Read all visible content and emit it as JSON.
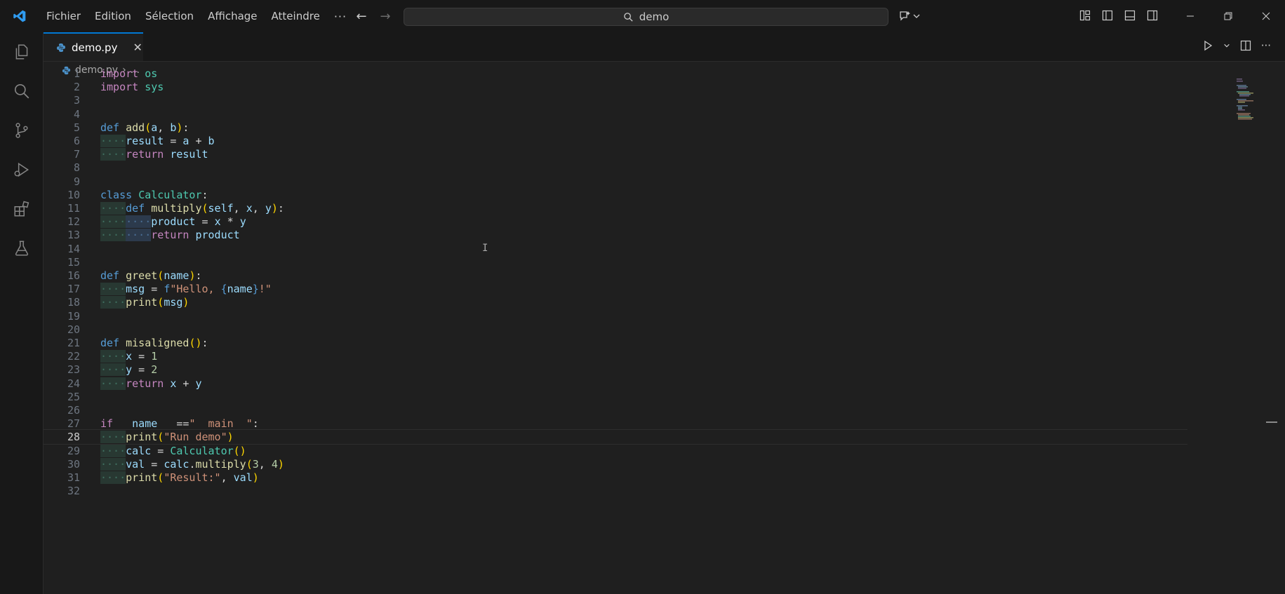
{
  "menu": {
    "items": [
      "Fichier",
      "Edition",
      "Sélection",
      "Affichage",
      "Atteindre"
    ],
    "more": "···"
  },
  "search": {
    "text": "demo"
  },
  "tab": {
    "label": "demo.py",
    "close": "✕"
  },
  "breadcrumb": {
    "file": "demo.py",
    "sep": "›",
    "rest": "..."
  },
  "colors": {
    "accent": "#0078d4",
    "background": "#1f1f1f",
    "chrome": "#181818"
  },
  "code": {
    "lines": [
      {
        "n": "1",
        "t": [
          [
            "kw",
            "import"
          ],
          [
            "op",
            " "
          ],
          [
            "cls",
            "os"
          ]
        ]
      },
      {
        "n": "2",
        "t": [
          [
            "kw",
            "import"
          ],
          [
            "op",
            " "
          ],
          [
            "cls",
            "sys"
          ]
        ]
      },
      {
        "n": "3",
        "t": []
      },
      {
        "n": "4",
        "t": []
      },
      {
        "n": "5",
        "t": [
          [
            "kd",
            "def"
          ],
          [
            "op",
            " "
          ],
          [
            "fn",
            "add"
          ],
          [
            "pn",
            "("
          ],
          [
            "var",
            "a"
          ],
          [
            "op",
            ", "
          ],
          [
            "var",
            "b"
          ],
          [
            "pn",
            ")"
          ],
          [
            "op",
            ":"
          ]
        ]
      },
      {
        "n": "6",
        "t": [
          [
            "i1",
            "····"
          ],
          [
            "var",
            "result"
          ],
          [
            "op",
            " = "
          ],
          [
            "var",
            "a"
          ],
          [
            "op",
            " + "
          ],
          [
            "var",
            "b"
          ]
        ]
      },
      {
        "n": "7",
        "t": [
          [
            "i1",
            "····"
          ],
          [
            "kw",
            "return"
          ],
          [
            "op",
            " "
          ],
          [
            "var",
            "result"
          ]
        ]
      },
      {
        "n": "8",
        "t": []
      },
      {
        "n": "9",
        "t": []
      },
      {
        "n": "10",
        "t": [
          [
            "kd",
            "class"
          ],
          [
            "op",
            " "
          ],
          [
            "cls",
            "Calculator"
          ],
          [
            "op",
            ":"
          ]
        ]
      },
      {
        "n": "11",
        "t": [
          [
            "i1",
            "····"
          ],
          [
            "kd",
            "def"
          ],
          [
            "op",
            " "
          ],
          [
            "fn",
            "multiply"
          ],
          [
            "pn",
            "("
          ],
          [
            "var",
            "self"
          ],
          [
            "op",
            ", "
          ],
          [
            "var",
            "x"
          ],
          [
            "op",
            ", "
          ],
          [
            "var",
            "y"
          ],
          [
            "pn",
            ")"
          ],
          [
            "op",
            ":"
          ]
        ]
      },
      {
        "n": "12",
        "t": [
          [
            "i1",
            "····"
          ],
          [
            "i2",
            "····"
          ],
          [
            "var",
            "product"
          ],
          [
            "op",
            " = "
          ],
          [
            "var",
            "x"
          ],
          [
            "op",
            " * "
          ],
          [
            "var",
            "y"
          ]
        ]
      },
      {
        "n": "13",
        "t": [
          [
            "i1",
            "····"
          ],
          [
            "i2",
            "····"
          ],
          [
            "kw",
            "return"
          ],
          [
            "op",
            " "
          ],
          [
            "var",
            "product"
          ]
        ]
      },
      {
        "n": "14",
        "t": []
      },
      {
        "n": "15",
        "t": []
      },
      {
        "n": "16",
        "t": [
          [
            "kd",
            "def"
          ],
          [
            "op",
            " "
          ],
          [
            "fn",
            "greet"
          ],
          [
            "pn",
            "("
          ],
          [
            "var",
            "name"
          ],
          [
            "pn",
            ")"
          ],
          [
            "op",
            ":"
          ]
        ]
      },
      {
        "n": "17",
        "t": [
          [
            "i1",
            "····"
          ],
          [
            "var",
            "msg"
          ],
          [
            "op",
            " = "
          ],
          [
            "kd",
            "f"
          ],
          [
            "str",
            "\"Hello, "
          ],
          [
            "kd",
            "{"
          ],
          [
            "var",
            "name"
          ],
          [
            "kd",
            "}"
          ],
          [
            "str",
            "!\""
          ]
        ]
      },
      {
        "n": "18",
        "t": [
          [
            "i1",
            "····"
          ],
          [
            "fn",
            "print"
          ],
          [
            "pn",
            "("
          ],
          [
            "var",
            "msg"
          ],
          [
            "pn",
            ")"
          ]
        ]
      },
      {
        "n": "19",
        "t": []
      },
      {
        "n": "20",
        "t": []
      },
      {
        "n": "21",
        "t": [
          [
            "kd",
            "def"
          ],
          [
            "op",
            " "
          ],
          [
            "fn",
            "misaligned"
          ],
          [
            "pn",
            "()"
          ],
          [
            "op",
            ":"
          ]
        ]
      },
      {
        "n": "22",
        "t": [
          [
            "i1",
            "····"
          ],
          [
            "var",
            "x"
          ],
          [
            "op",
            " = "
          ],
          [
            "num",
            "1"
          ]
        ]
      },
      {
        "n": "23",
        "t": [
          [
            "i1",
            "····"
          ],
          [
            "var",
            "y"
          ],
          [
            "op",
            " = "
          ],
          [
            "num",
            "2"
          ]
        ]
      },
      {
        "n": "24",
        "t": [
          [
            "i1",
            "····"
          ],
          [
            "kw",
            "return"
          ],
          [
            "op",
            " "
          ],
          [
            "var",
            "x"
          ],
          [
            "op",
            " + "
          ],
          [
            "var",
            "y"
          ]
        ]
      },
      {
        "n": "25",
        "t": []
      },
      {
        "n": "26",
        "t": []
      },
      {
        "n": "27",
        "t": [
          [
            "kw",
            "if"
          ],
          [
            "op",
            " "
          ],
          [
            "var",
            "__name__"
          ],
          [
            "op",
            " =="
          ],
          [
            "str",
            "\"__main__\""
          ],
          [
            "op",
            ":"
          ]
        ]
      },
      {
        "n": "28",
        "t": [
          [
            "i1",
            "····"
          ],
          [
            "fn",
            "print"
          ],
          [
            "pn",
            "("
          ],
          [
            "str",
            "\"Run demo\""
          ],
          [
            "pn",
            ")"
          ]
        ],
        "current": true
      },
      {
        "n": "29",
        "t": [
          [
            "i1",
            "····"
          ],
          [
            "var",
            "calc"
          ],
          [
            "op",
            " = "
          ],
          [
            "cls",
            "Calculator"
          ],
          [
            "pn",
            "()"
          ]
        ]
      },
      {
        "n": "30",
        "t": [
          [
            "i1",
            "····"
          ],
          [
            "var",
            "val"
          ],
          [
            "op",
            " = "
          ],
          [
            "var",
            "calc"
          ],
          [
            "op",
            "."
          ],
          [
            "fn",
            "multiply"
          ],
          [
            "pn",
            "("
          ],
          [
            "num",
            "3"
          ],
          [
            "op",
            ", "
          ],
          [
            "num",
            "4"
          ],
          [
            "pn",
            ")"
          ]
        ]
      },
      {
        "n": "31",
        "t": [
          [
            "i1",
            "····"
          ],
          [
            "fn",
            "print"
          ],
          [
            "pn",
            "("
          ],
          [
            "str",
            "\"Result:\""
          ],
          [
            "op",
            ", "
          ],
          [
            "var",
            "val"
          ],
          [
            "pn",
            ")"
          ]
        ]
      },
      {
        "n": "32",
        "t": []
      }
    ]
  }
}
